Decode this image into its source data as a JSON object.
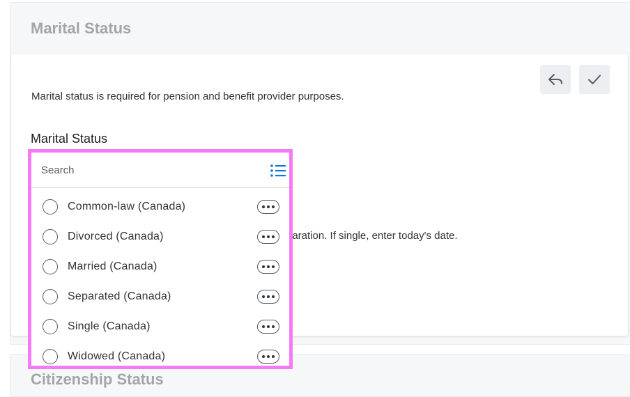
{
  "section": {
    "title": "Marital Status",
    "next_title": "Citizenship Status"
  },
  "card": {
    "description": "Marital status is required for pension and benefit provider purposes.",
    "partial_instruction": "paration. If single, enter today's date.",
    "field_label": "Marital Status",
    "actions": [
      {
        "name": "cancel",
        "icon": "reply-arrow-icon"
      },
      {
        "name": "save",
        "icon": "checkmark-icon"
      }
    ]
  },
  "dropdown": {
    "search_placeholder": "Search",
    "list_icon": "list-icon",
    "options": [
      {
        "label": "Common-law (Canada)",
        "selected": false
      },
      {
        "label": "Divorced (Canada)",
        "selected": false
      },
      {
        "label": "Married (Canada)",
        "selected": false
      },
      {
        "label": "Separated (Canada)",
        "selected": false
      },
      {
        "label": "Single (Canada)",
        "selected": false
      },
      {
        "label": "Widowed (Canada)",
        "selected": false
      }
    ]
  },
  "colors": {
    "accent": "#0875e1",
    "highlight": "#f57af5",
    "muted_title": "#a2a5a9"
  }
}
